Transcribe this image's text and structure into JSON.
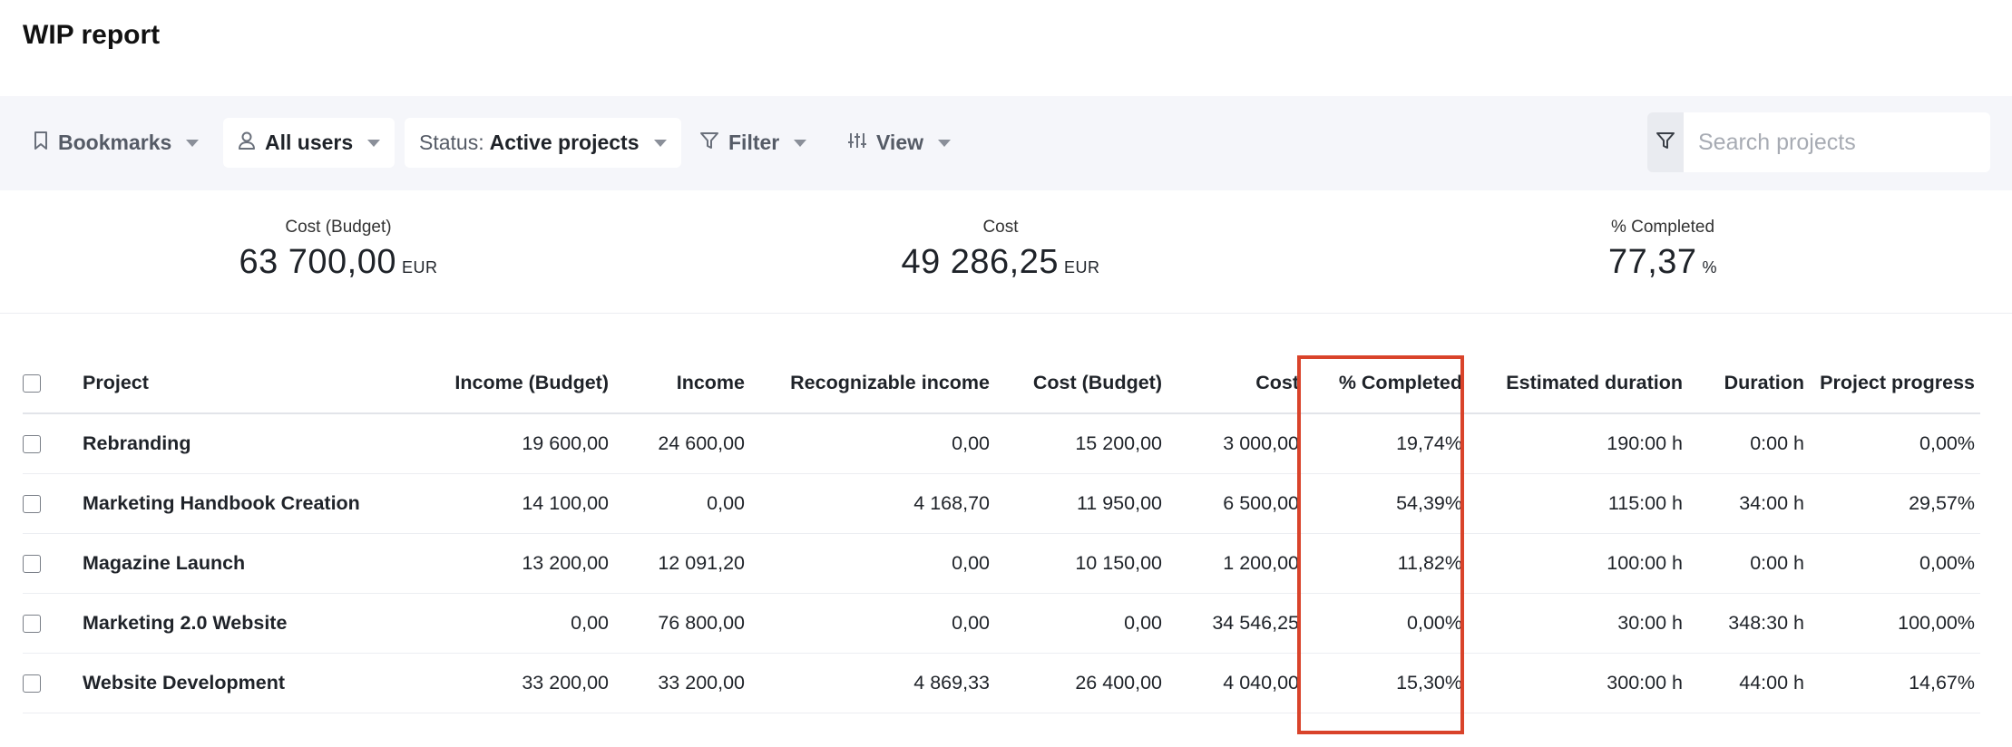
{
  "page": {
    "title": "WIP report"
  },
  "toolbar": {
    "bookmarks_label": "Bookmarks",
    "users_label": "All users",
    "status_prefix": "Status:",
    "status_value": "Active projects",
    "filter_label": "Filter",
    "view_label": "View",
    "search_placeholder": "Search projects"
  },
  "summary": [
    {
      "label": "Cost (Budget)",
      "value": "63 700,00",
      "unit": "EUR"
    },
    {
      "label": "Cost",
      "value": "49 286,25",
      "unit": "EUR"
    },
    {
      "label": "% Completed",
      "value": "77,37",
      "unit": "%"
    }
  ],
  "table": {
    "columns": [
      "Project",
      "Income (Budget)",
      "Income",
      "Recognizable income",
      "Cost (Budget)",
      "Cost",
      "% Completed",
      "Estimated duration",
      "Duration",
      "Project progress"
    ],
    "rows": [
      {
        "project": "Rebranding",
        "income_budget": "19 600,00",
        "income": "24 600,00",
        "recognizable_income": "0,00",
        "cost_budget": "15 200,00",
        "cost": "3 000,00",
        "completed": "19,74%",
        "estimated_duration": "190:00 h",
        "duration": "0:00 h",
        "progress": "0,00%"
      },
      {
        "project": "Marketing Handbook Creation",
        "income_budget": "14 100,00",
        "income": "0,00",
        "recognizable_income": "4 168,70",
        "cost_budget": "11 950,00",
        "cost": "6 500,00",
        "completed": "54,39%",
        "estimated_duration": "115:00 h",
        "duration": "34:00 h",
        "progress": "29,57%"
      },
      {
        "project": "Magazine Launch",
        "income_budget": "13 200,00",
        "income": "12 091,20",
        "recognizable_income": "0,00",
        "cost_budget": "10 150,00",
        "cost": "1 200,00",
        "completed": "11,82%",
        "estimated_duration": "100:00 h",
        "duration": "0:00 h",
        "progress": "0,00%"
      },
      {
        "project": "Marketing 2.0 Website",
        "income_budget": "0,00",
        "income": "76 800,00",
        "recognizable_income": "0,00",
        "cost_budget": "0,00",
        "cost": "34 546,25",
        "completed": "0,00%",
        "estimated_duration": "30:00 h",
        "duration": "348:30 h",
        "progress": "100,00%"
      },
      {
        "project": "Website Development",
        "income_budget": "33 200,00",
        "income": "33 200,00",
        "recognizable_income": "4 869,33",
        "cost_budget": "26 400,00",
        "cost": "4 040,00",
        "completed": "15,30%",
        "estimated_duration": "300:00 h",
        "duration": "44:00 h",
        "progress": "14,67%"
      }
    ]
  },
  "colors": {
    "highlight": "#d9432a",
    "toolbar_bg": "#f5f6fa"
  }
}
